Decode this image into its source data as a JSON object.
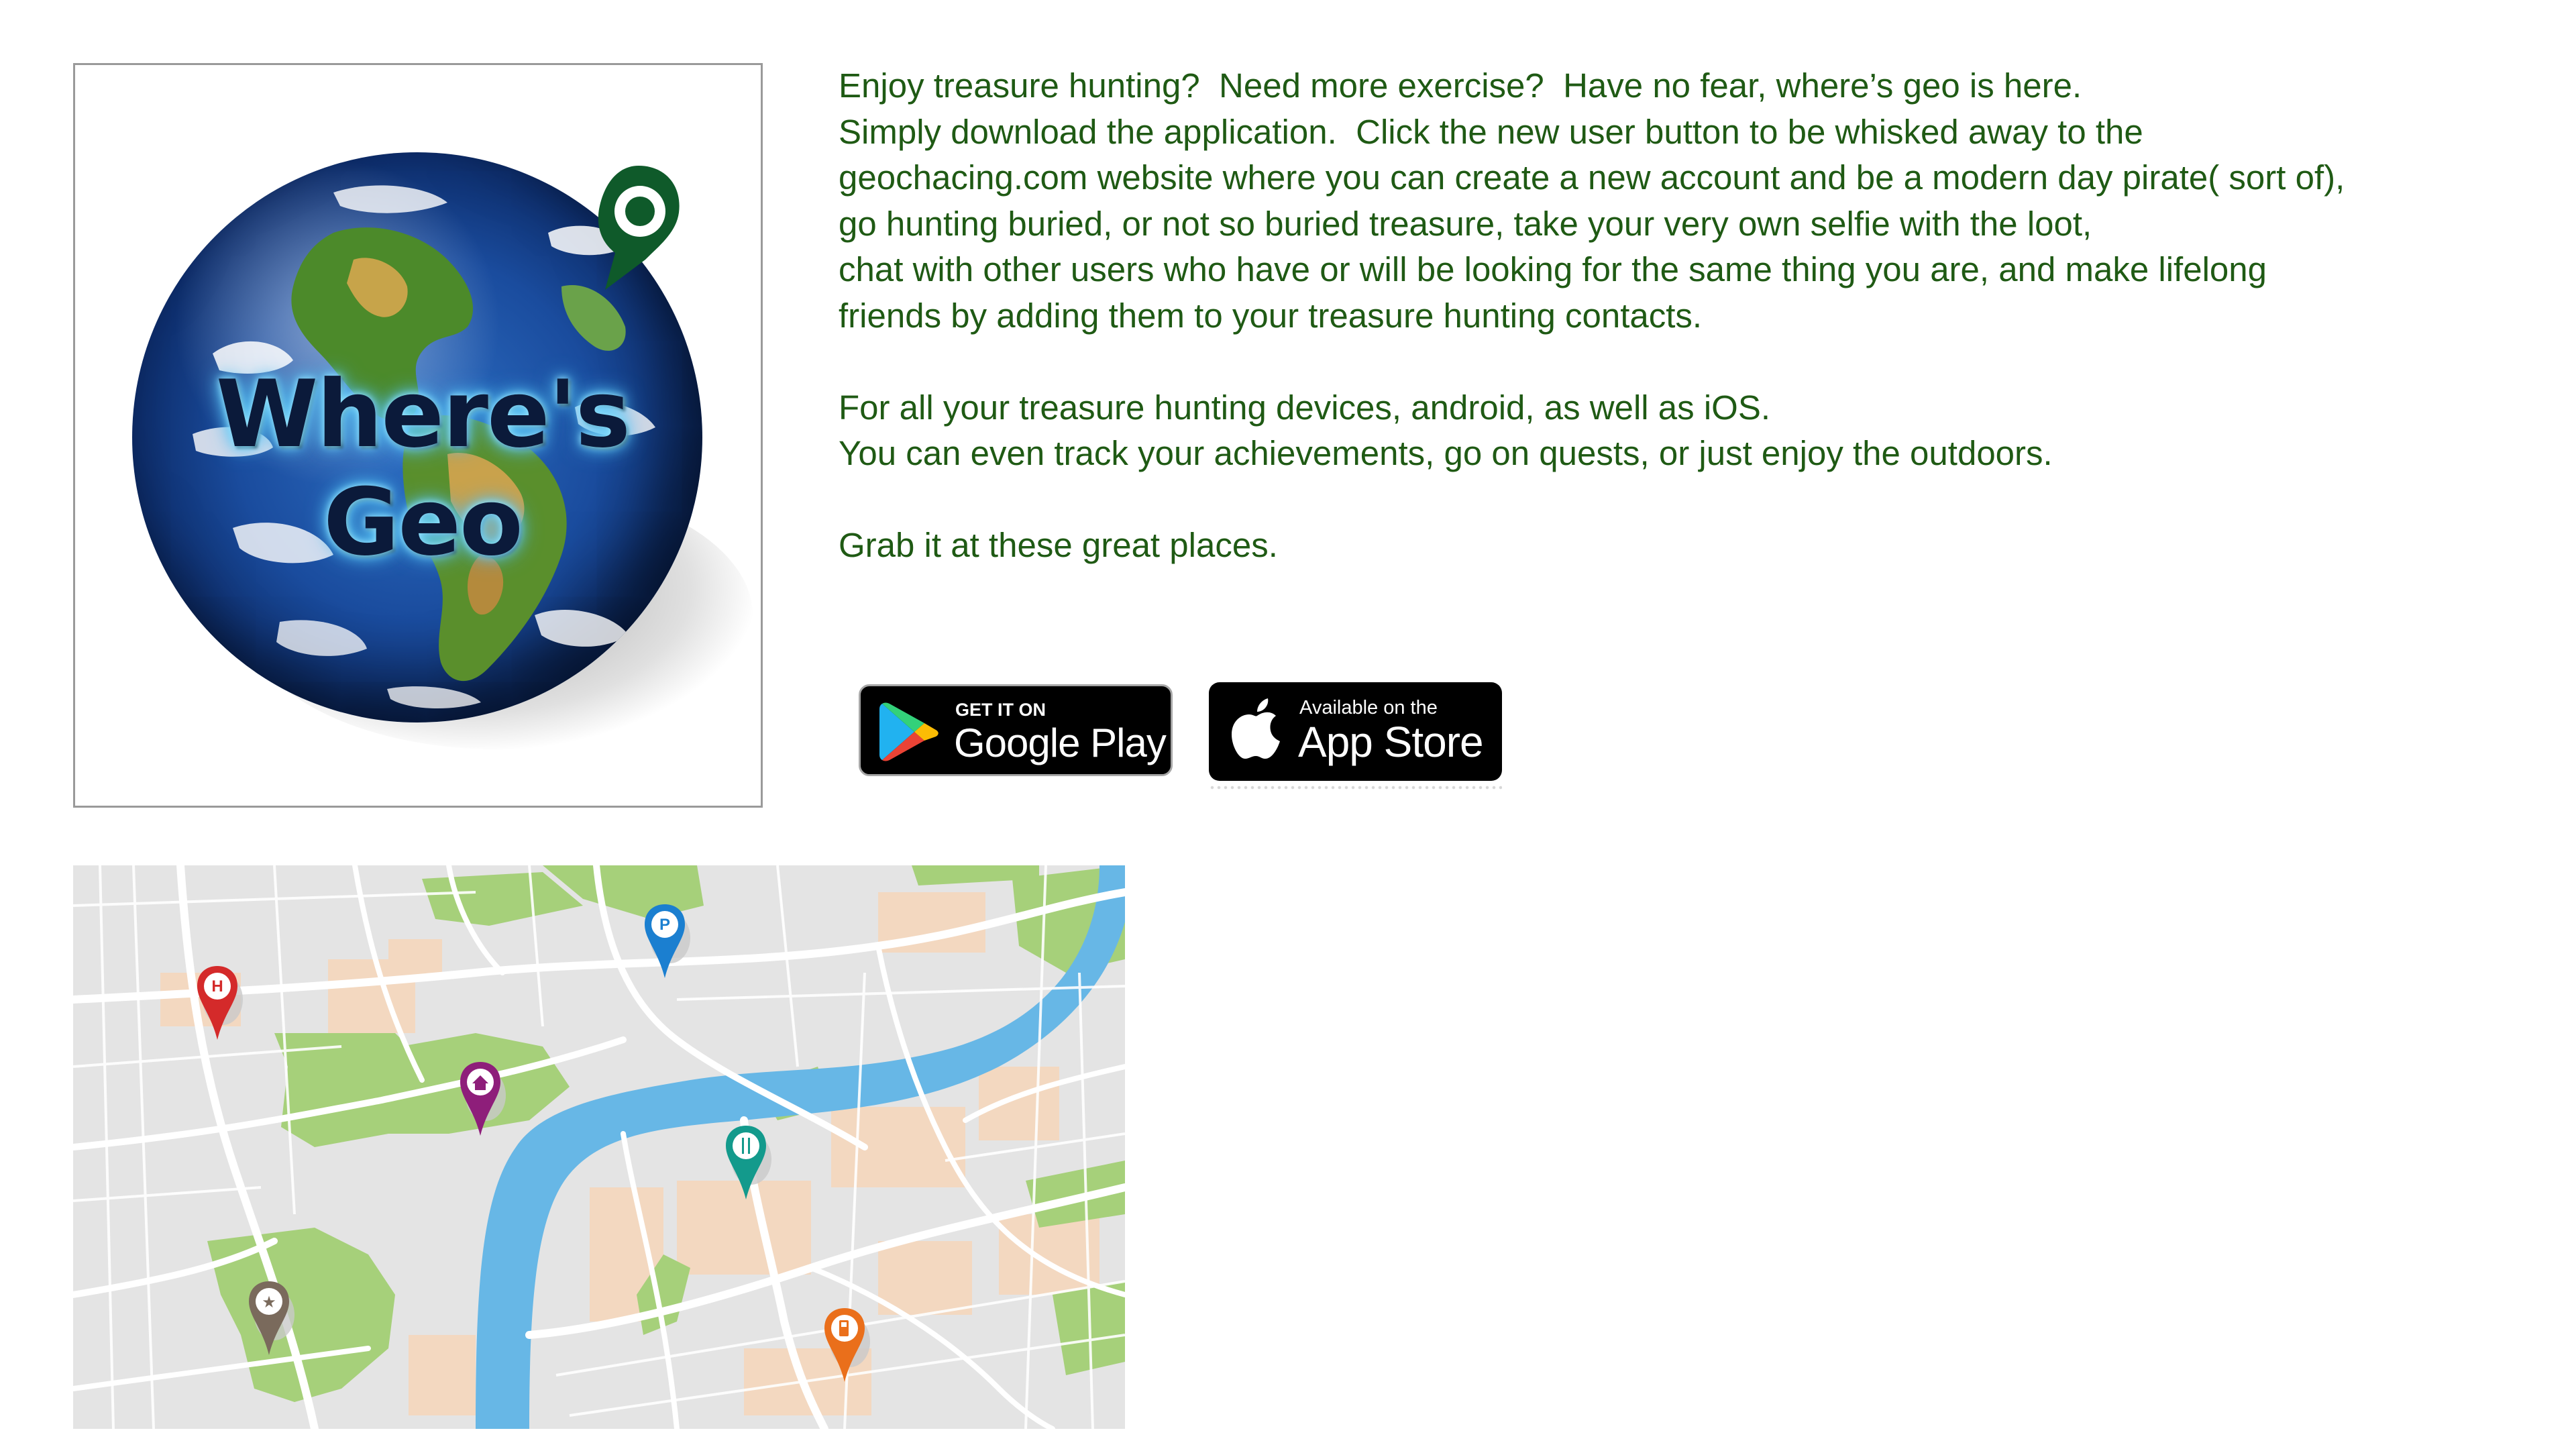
{
  "logo": {
    "title": "Where's Geo",
    "globe_icon": "earth-globe-icon",
    "pin_icon": "map-pin-icon",
    "accent_green": "#1f5a14"
  },
  "description": {
    "paragraph1_lines": [
      "Enjoy treasure hunting?  Need more exercise?  Have no fear, where’s geo is here.",
      "Simply download the application.  Click the new user button to be whisked away to the",
      "geochacing.com website where you can create a new account and be a modern day pirate( sort of),",
      "go hunting buried, or not so buried treasure, take your very own selfie with the loot,",
      "chat with other users who have or will be looking for the same thing you are, and make lifelong",
      "friends by adding them to your treasure hunting contacts."
    ],
    "paragraph2_lines": [
      "For all your treasure hunting devices, android, as well as iOS.",
      "You can even track your achievements, go on quests, or just enjoy the outdoors."
    ],
    "paragraph3": "Grab it at these great places.",
    "text_color": "#1f5a14"
  },
  "badges": {
    "google": {
      "small": "GET IT ON",
      "big": "Google Play",
      "icon": "google-play-icon"
    },
    "apple": {
      "small": "Available on the",
      "big": "App Store",
      "icon": "apple-icon"
    }
  },
  "map": {
    "pins": [
      {
        "name": "hospital",
        "letter": "H",
        "color": "#d42a2a",
        "icon": "hospital-pin-icon"
      },
      {
        "name": "parking",
        "letter": "P",
        "color": "#1b7fd0",
        "icon": "parking-pin-icon"
      },
      {
        "name": "home",
        "letter": "⌂",
        "color": "#8e1e7a",
        "icon": "home-pin-icon"
      },
      {
        "name": "restaurant",
        "letter": "🍴",
        "color": "#139a8c",
        "icon": "restaurant-pin-icon"
      },
      {
        "name": "landmark",
        "letter": "★",
        "color": "#7a6a5c",
        "icon": "star-pin-icon"
      },
      {
        "name": "fuel",
        "letter": "⛽",
        "color": "#ea6f1b",
        "icon": "fuel-pin-icon"
      }
    ],
    "colors": {
      "land": "#e4e4e4",
      "park": "#a6d07a",
      "river": "#67b7e6",
      "blocks": "#f3d8c0",
      "roads": "#ffffff"
    }
  }
}
